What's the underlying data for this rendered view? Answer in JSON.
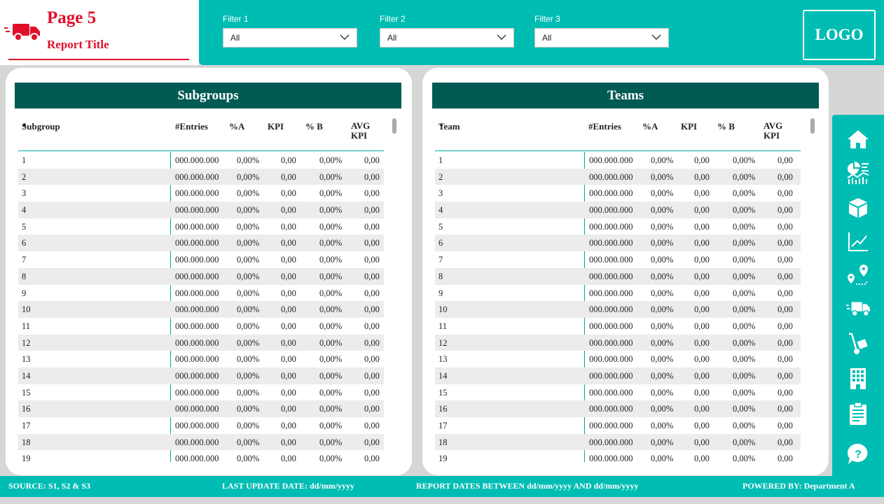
{
  "header": {
    "page_number": "Page 5",
    "report_title": "Report Title",
    "logo_text": "LOGO"
  },
  "filters": [
    {
      "label": "Filter 1",
      "value": "All"
    },
    {
      "label": "Filter 2",
      "value": "All"
    },
    {
      "label": "Filter 3",
      "value": "All"
    }
  ],
  "subgroups": {
    "title": "Subgroups",
    "columns": [
      "Subgroup",
      "#Entries",
      "%A",
      "KPI",
      "% B",
      "AVG KPI"
    ],
    "rows": [
      [
        "1",
        "000.000.000",
        "0,00%",
        "0,00",
        "0,00%",
        "0,00"
      ],
      [
        "2",
        "000.000.000",
        "0,00%",
        "0,00",
        "0,00%",
        "0,00"
      ],
      [
        "3",
        "000.000.000",
        "0,00%",
        "0,00",
        "0,00%",
        "0,00"
      ],
      [
        "4",
        "000.000.000",
        "0,00%",
        "0,00",
        "0,00%",
        "0,00"
      ],
      [
        "5",
        "000.000.000",
        "0,00%",
        "0,00",
        "0,00%",
        "0,00"
      ],
      [
        "6",
        "000.000.000",
        "0,00%",
        "0,00",
        "0,00%",
        "0,00"
      ],
      [
        "7",
        "000.000.000",
        "0,00%",
        "0,00",
        "0,00%",
        "0,00"
      ],
      [
        "8",
        "000.000.000",
        "0,00%",
        "0,00",
        "0,00%",
        "0,00"
      ],
      [
        "9",
        "000.000.000",
        "0,00%",
        "0,00",
        "0,00%",
        "0,00"
      ],
      [
        "10",
        "000.000.000",
        "0,00%",
        "0,00",
        "0,00%",
        "0,00"
      ],
      [
        "11",
        "000.000.000",
        "0,00%",
        "0,00",
        "0,00%",
        "0,00"
      ],
      [
        "12",
        "000.000.000",
        "0,00%",
        "0,00",
        "0,00%",
        "0,00"
      ],
      [
        "13",
        "000.000.000",
        "0,00%",
        "0,00",
        "0,00%",
        "0,00"
      ],
      [
        "14",
        "000.000.000",
        "0,00%",
        "0,00",
        "0,00%",
        "0,00"
      ],
      [
        "15",
        "000.000.000",
        "0,00%",
        "0,00",
        "0,00%",
        "0,00"
      ],
      [
        "16",
        "000.000.000",
        "0,00%",
        "0,00",
        "0,00%",
        "0,00"
      ],
      [
        "17",
        "000.000.000",
        "0,00%",
        "0,00",
        "0,00%",
        "0,00"
      ],
      [
        "18",
        "000.000.000",
        "0,00%",
        "0,00",
        "0,00%",
        "0,00"
      ],
      [
        "19",
        "000.000.000",
        "0,00%",
        "0,00",
        "0,00%",
        "0,00"
      ]
    ]
  },
  "teams": {
    "title": "Teams",
    "columns": [
      "Team",
      "#Entries",
      "%A",
      "KPI",
      "% B",
      "AVG KPI"
    ],
    "rows": [
      [
        "1",
        "000.000.000",
        "0,00%",
        "0,00",
        "0,00%",
        "0,00"
      ],
      [
        "2",
        "000.000.000",
        "0,00%",
        "0,00",
        "0,00%",
        "0,00"
      ],
      [
        "3",
        "000.000.000",
        "0,00%",
        "0,00",
        "0,00%",
        "0,00"
      ],
      [
        "4",
        "000.000.000",
        "0,00%",
        "0,00",
        "0,00%",
        "0,00"
      ],
      [
        "5",
        "000.000.000",
        "0,00%",
        "0,00",
        "0,00%",
        "0,00"
      ],
      [
        "6",
        "000.000.000",
        "0,00%",
        "0,00",
        "0,00%",
        "0,00"
      ],
      [
        "7",
        "000.000.000",
        "0,00%",
        "0,00",
        "0,00%",
        "0,00"
      ],
      [
        "8",
        "000.000.000",
        "0,00%",
        "0,00",
        "0,00%",
        "0,00"
      ],
      [
        "9",
        "000.000.000",
        "0,00%",
        "0,00",
        "0,00%",
        "0,00"
      ],
      [
        "10",
        "000.000.000",
        "0,00%",
        "0,00",
        "0,00%",
        "0,00"
      ],
      [
        "11",
        "000.000.000",
        "0,00%",
        "0,00",
        "0,00%",
        "0,00"
      ],
      [
        "12",
        "000.000.000",
        "0,00%",
        "0,00",
        "0,00%",
        "0,00"
      ],
      [
        "13",
        "000.000.000",
        "0,00%",
        "0,00",
        "0,00%",
        "0,00"
      ],
      [
        "14",
        "000.000.000",
        "0,00%",
        "0,00",
        "0,00%",
        "0,00"
      ],
      [
        "15",
        "000.000.000",
        "0,00%",
        "0,00",
        "0,00%",
        "0,00"
      ],
      [
        "16",
        "000.000.000",
        "0,00%",
        "0,00",
        "0,00%",
        "0,00"
      ],
      [
        "17",
        "000.000.000",
        "0,00%",
        "0,00",
        "0,00%",
        "0,00"
      ],
      [
        "18",
        "000.000.000",
        "0,00%",
        "0,00",
        "0,00%",
        "0,00"
      ],
      [
        "19",
        "000.000.000",
        "0,00%",
        "0,00",
        "0,00%",
        "0,00"
      ]
    ]
  },
  "nav": {
    "icons": [
      "home-icon",
      "dashboard-chart-icon",
      "box-icon",
      "line-chart-icon",
      "route-pin-icon",
      "delivery-truck-icon",
      "hand-truck-icon",
      "building-icon",
      "clipboard-icon",
      "help-icon"
    ]
  },
  "footer": {
    "source": "SOURCE: S1, S2 & S3",
    "last_update": "LAST UPDATE DATE:  dd/mm/yyyy",
    "report_dates": "REPORT DATES BETWEEN dd/mm/yyyy AND dd/mm/yyyy",
    "powered_by": "POWERED BY: Department A"
  },
  "colors": {
    "accent": "#00bdb4",
    "dark_header": "#005b54",
    "title_red": "#e0102a",
    "background": "#d6d6d6"
  }
}
